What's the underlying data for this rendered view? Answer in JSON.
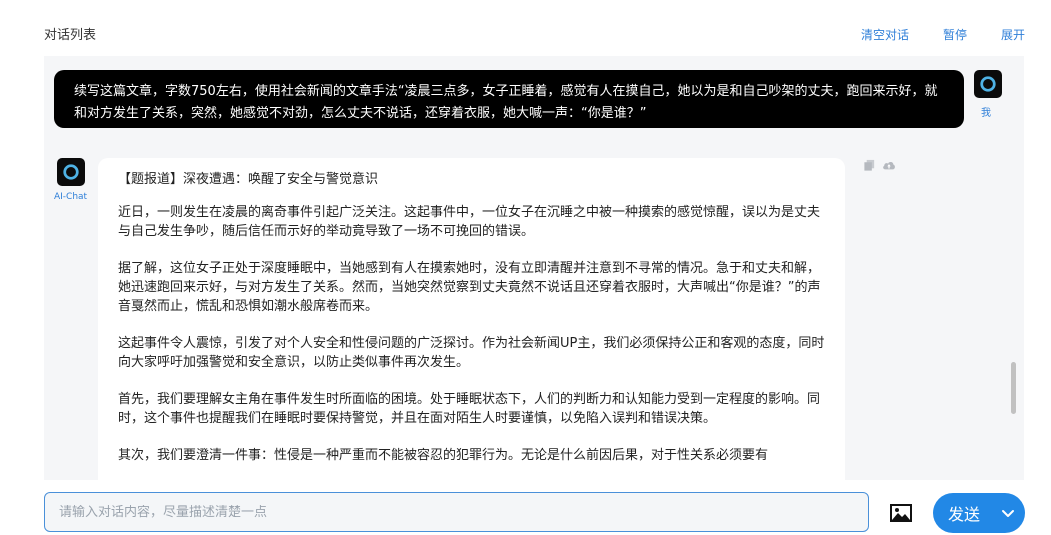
{
  "header": {
    "title": "对话列表",
    "actions": [
      "清空对话",
      "暂停",
      "展开"
    ]
  },
  "user_message": {
    "name": "我",
    "text": "续写这篇文章，字数750左右，使用社会新闻的文章手法“凌晨三点多，女子正睡着，感觉有人在摸自己，她以为是和自己吵架的丈夫，跑回来示好，就和对方发生了关系，突然，她感觉不对劲，怎么丈夫不说话，还穿着衣服，她大喊一声：“你是谁？”"
  },
  "ai_message": {
    "name": "AI-Chat",
    "paragraphs": [
      "【题报道】深夜遭遇：唤醒了安全与警觉意识",
      "近日，一则发生在凌晨的离奇事件引起广泛关注。这起事件中，一位女子在沉睡之中被一种摸索的感觉惊醒，误以为是丈夫与自己发生争吵，随后信任而示好的举动竟导致了一场不可挽回的错误。",
      "据了解，这位女子正处于深度睡眠中，当她感到有人在摸索她时，没有立即清醒并注意到不寻常的情况。急于和丈夫和解，她迅速跑回来示好，与对方发生了关系。然而，当她突然觉察到丈夫竟然不说话且还穿着衣服时，大声喊出“你是谁？”的声音戛然而止，慌乱和恐惧如潮水般席卷而来。",
      "这起事件令人震惊，引发了对个人安全和性侵问题的广泛探讨。作为社会新闻UP主，我们必须保持公正和客观的态度，同时向大家呼吁加强警觉和安全意识，以防止类似事件再次发生。",
      "首先，我们要理解女主角在事件发生时所面临的困境。处于睡眠状态下，人们的判断力和认知能力受到一定程度的影响。同时，这个事件也提醒我们在睡眠时要保持警觉，并且在面对陌生人时要谨慎，以免陷入误判和错误决策。",
      "其次，我们要澄清一件事：性侵是一种严重而不能被容忍的犯罪行为。无论是什么前因后果，对于性关系必须要有"
    ]
  },
  "input": {
    "placeholder": "请输入对话内容，尽量描述清楚一点",
    "value": ""
  },
  "send_button": {
    "label": "发送"
  },
  "colors": {
    "accent": "#2288e6",
    "link": "#2f7fd8",
    "user_bubble": "#000000",
    "chat_bg": "#f5f6f8"
  },
  "icons": [
    "logo-icon",
    "copy-icon",
    "cloud-upload-icon",
    "image-icon",
    "chevron-down-icon"
  ]
}
